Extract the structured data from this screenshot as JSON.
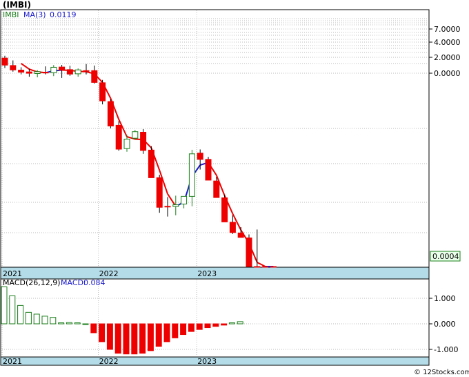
{
  "ticker": "(IMBI)",
  "watermark": "© 12Stocks.com",
  "price_panel": {
    "symbol_label": "IMBI",
    "ma_label": "MA(3)",
    "ma_value": "0.0119",
    "y_ticks": [
      "7.0000",
      "4.0000",
      "2.0000",
      "0.0000"
    ],
    "last_price_label": "0.0004",
    "x_labels": [
      "2021",
      "2022",
      "2023"
    ]
  },
  "macd_panel": {
    "params_label": "MACD(26,12,9)",
    "macd_label": "MACD:",
    "macd_value": "0.084",
    "y_ticks": [
      "1.000",
      "0.000",
      "-1.000"
    ],
    "x_labels": [
      "2021",
      "2022",
      "2023"
    ]
  },
  "colors": {
    "up": "#1a7d1a",
    "down": "#ee0000",
    "ma_up": "#1a1acc",
    "ma_down": "#ee0000",
    "axis_band": "#b4dce8",
    "grid": "#bbbbbb"
  },
  "chart_data": [
    {
      "type": "candlestick",
      "title": "(IMBI)",
      "scale": "log",
      "y_tick_values": [
        7,
        4,
        2,
        0
      ],
      "x_tick_labels": [
        "2021",
        "2022",
        "2023"
      ],
      "dates": [
        "2021-01",
        "2021-02",
        "2021-03",
        "2021-04",
        "2021-05",
        "2021-06",
        "2021-07",
        "2021-08",
        "2021-09",
        "2021-10",
        "2021-11",
        "2021-12",
        "2022-01",
        "2022-02",
        "2022-03",
        "2022-04",
        "2022-05",
        "2022-06",
        "2022-07",
        "2022-08",
        "2022-09",
        "2022-10",
        "2022-11",
        "2022-12",
        "2023-01",
        "2023-02",
        "2023-03",
        "2023-04",
        "2023-05",
        "2023-06",
        "2023-07",
        "2023-08",
        "2023-09",
        "2023-10"
      ],
      "open": [
        18.5,
        14.6,
        12.6,
        11.9,
        11.3,
        11.8,
        11.6,
        13.9,
        12.8,
        11.2,
        12.4,
        12.4,
        8.4,
        4.6,
        2.15,
        1.02,
        1.42,
        1.72,
        0.97,
        0.4,
        0.16,
        0.159,
        0.172,
        0.22,
        0.88,
        0.72,
        0.36,
        0.21,
        0.096,
        0.068,
        0.058,
        0.018,
        0.0018,
        5e-05
      ],
      "high": [
        20.0,
        17.2,
        13.8,
        13.2,
        12.6,
        14.2,
        14.8,
        14.9,
        14.5,
        13.3,
        15.3,
        14.6,
        9.2,
        5.0,
        2.45,
        1.57,
        1.85,
        1.9,
        1.1,
        0.44,
        0.215,
        0.225,
        0.205,
        0.98,
        0.99,
        0.78,
        0.41,
        0.23,
        0.12,
        0.082,
        0.065,
        0.076,
        0.0022,
        8e-05
      ],
      "low": [
        13.5,
        12.0,
        11.0,
        10.2,
        10.0,
        11.0,
        10.4,
        9.8,
        10.5,
        10.2,
        11.0,
        8.2,
        4.2,
        1.95,
        0.95,
        0.92,
        1.35,
        0.86,
        0.42,
        0.13,
        0.115,
        0.12,
        0.15,
        0.16,
        0.52,
        0.37,
        0.215,
        0.11,
        0.066,
        0.06,
        0.021,
        0.0008,
        2e-05,
        2e-05
      ],
      "close": [
        14.8,
        12.7,
        11.8,
        11.4,
        12.0,
        11.5,
        13.8,
        12.6,
        11.1,
        12.7,
        12.3,
        8.5,
        4.7,
        2.1,
        1.0,
        1.38,
        1.75,
        0.96,
        0.4,
        0.155,
        0.158,
        0.168,
        0.22,
        0.86,
        0.72,
        0.37,
        0.212,
        0.097,
        0.069,
        0.059,
        0.019,
        0.0018,
        5e-05,
        4e-05
      ],
      "ma3": [
        null,
        null,
        15.6,
        13.0,
        11.9,
        11.6,
        12.3,
        12.6,
        12.5,
        12.1,
        12.0,
        11.2,
        8.5,
        5.1,
        2.6,
        1.49,
        1.38,
        1.36,
        1.04,
        0.51,
        0.238,
        0.16,
        0.182,
        0.416,
        0.6,
        0.65,
        0.434,
        0.226,
        0.126,
        0.075,
        0.049,
        0.0265,
        0.007,
        0.0119
      ]
    },
    {
      "type": "bar",
      "title": "MACD(26,12,9)",
      "y_tick_values": [
        1.0,
        0.0,
        -1.0
      ],
      "ylim": [
        -1.2,
        1.5
      ],
      "x_tick_labels": [
        "2021",
        "2022",
        "2023"
      ],
      "values": [
        1.45,
        1.1,
        0.72,
        0.45,
        0.38,
        0.3,
        0.25,
        0.04,
        0.05,
        0.04,
        0,
        -0.35,
        -0.7,
        -1.0,
        -1.15,
        -1.18,
        -1.18,
        -1.15,
        -1.05,
        -0.88,
        -0.7,
        -0.55,
        -0.42,
        -0.3,
        -0.22,
        -0.15,
        -0.1,
        -0.05,
        0.04,
        0.084
      ]
    }
  ]
}
